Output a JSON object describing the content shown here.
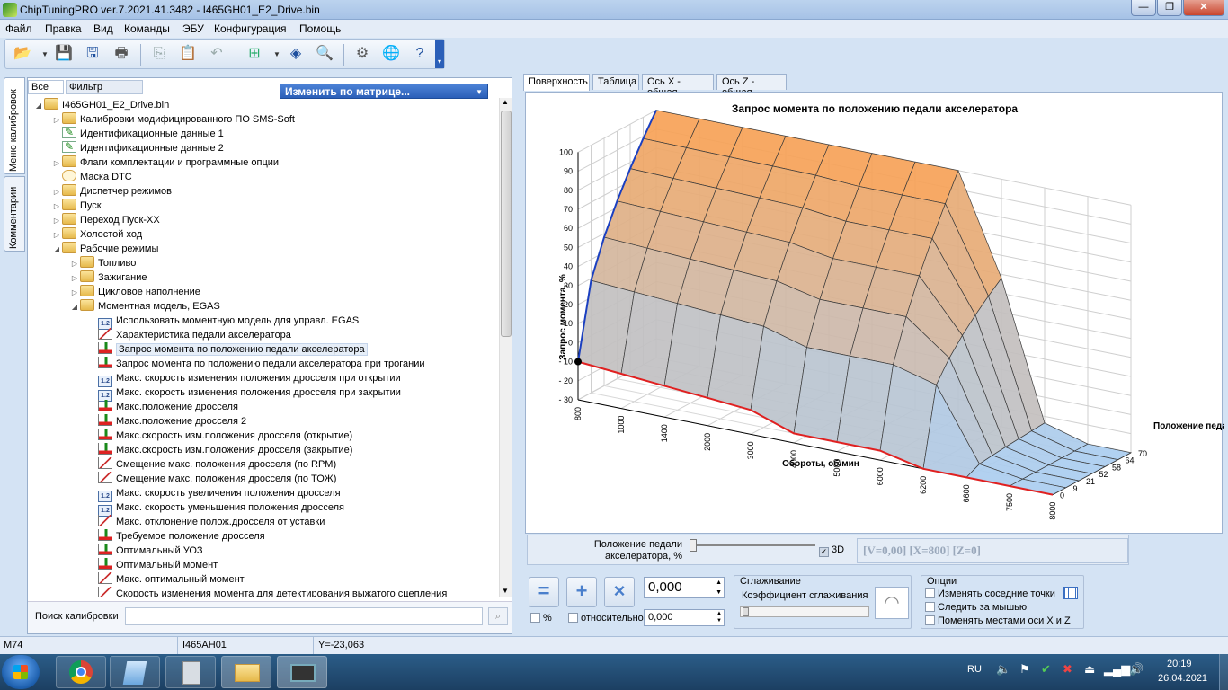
{
  "window": {
    "title": "ChipTuningPRO ver.7.2021.41.3482 - I465GH01_E2_Drive.bin",
    "minimize": "—",
    "restore": "❐",
    "close": "✕"
  },
  "menu": [
    "Файл",
    "Правка",
    "Вид",
    "Команды",
    "ЭБУ",
    "Конфигурация",
    "Помощь"
  ],
  "side_tabs": {
    "calib": "Меню калибровок",
    "comments": "Комментарии"
  },
  "filter": {
    "all": "Все",
    "filter": "Фильтр",
    "matrix": "Изменить по матрице..."
  },
  "tree": {
    "root": "I465GH01_E2_Drive.bin",
    "top": [
      {
        "label": "Калибровки модифицированного ПО SMS-Soft",
        "icon": "folder",
        "arrow": "▷"
      },
      {
        "label": "Идентификационные данные 1",
        "icon": "note",
        "arrow": ""
      },
      {
        "label": "Идентификационные данные 2",
        "icon": "note",
        "arrow": ""
      },
      {
        "label": "Флаги комплектации и программные опции",
        "icon": "folder",
        "arrow": "▷"
      },
      {
        "label": "Маска DTC",
        "icon": "mask",
        "arrow": ""
      },
      {
        "label": "Диспетчер режимов",
        "icon": "folder",
        "arrow": "▷"
      },
      {
        "label": "Пуск",
        "icon": "folder",
        "arrow": "▷"
      },
      {
        "label": "Переход Пуск-ХХ",
        "icon": "folder",
        "arrow": "▷"
      },
      {
        "label": "Холостой ход",
        "icon": "folder",
        "arrow": "▷"
      },
      {
        "label": "Рабочие режимы",
        "icon": "folder",
        "arrow": "◢"
      }
    ],
    "sub": [
      {
        "label": "Топливо",
        "icon": "folder",
        "arrow": "▷"
      },
      {
        "label": "Зажигание",
        "icon": "folder",
        "arrow": "▷"
      },
      {
        "label": "Цикловое наполнение",
        "icon": "folder",
        "arrow": "▷"
      },
      {
        "label": "Моментная модель, EGAS",
        "icon": "folder",
        "arrow": "◢"
      }
    ],
    "leaves": [
      {
        "label": "Использовать моментную модель для управл. EGAS",
        "icon": "i12"
      },
      {
        "label": "Характеристика педали акселератора",
        "icon": "wave"
      },
      {
        "label": "Запрос момента по положению педали акселератора",
        "icon": "graph",
        "selected": true
      },
      {
        "label": "Запрос момента по положению педали акселератора при трогании",
        "icon": "graph"
      },
      {
        "label": "Макс. скорость изменения положения дросселя при открытии",
        "icon": "i12"
      },
      {
        "label": "Макс. скорость изменения положения дросселя при закрытии",
        "icon": "i12"
      },
      {
        "label": "Макс.положение дросселя",
        "icon": "graph"
      },
      {
        "label": "Макс.положение дросселя 2",
        "icon": "graph"
      },
      {
        "label": "Макс.скорость изм.положения дросселя (открытие)",
        "icon": "graph"
      },
      {
        "label": "Макс.скорость изм.положения дросселя (закрытие)",
        "icon": "graph"
      },
      {
        "label": "Смещение макс. положения дросселя (по RPM)",
        "icon": "wave"
      },
      {
        "label": "Смещение макс. положения дросселя (по ТОЖ)",
        "icon": "wave"
      },
      {
        "label": "Макс. скорость увеличения положения дросселя",
        "icon": "i12"
      },
      {
        "label": "Макс. скорость уменьшения положения дросселя",
        "icon": "i12"
      },
      {
        "label": "Макс. отклонение полож.дросселя от уставки",
        "icon": "wave"
      },
      {
        "label": "Требуемое положение дросселя",
        "icon": "graph"
      },
      {
        "label": "Оптимальный УОЗ",
        "icon": "graph"
      },
      {
        "label": "Оптимальный момент",
        "icon": "graph"
      },
      {
        "label": "Макс. оптимальный момент",
        "icon": "wave"
      },
      {
        "label": "Скорость изменения момента для детектирования выжатого сцепления",
        "icon": "wave"
      }
    ]
  },
  "search": {
    "label": "Поиск калибровки",
    "value": ""
  },
  "right_tabs": [
    "Поверхность",
    "Таблица",
    "Ось X - общая",
    "Ось Z - общая"
  ],
  "chart_data": {
    "type": "surface",
    "title": "Запрос момента по положению педали акселератора",
    "zlabel": "Запрос момента, %",
    "xlabel": "Обороты, об/мин",
    "ylabel": "Положение педали",
    "ticks_z": [
      "100",
      "90",
      "80",
      "70",
      "60",
      "50",
      "40",
      "30",
      "20",
      "10",
      "0",
      "- 10",
      "- 20",
      "- 30"
    ],
    "ticks_x": [
      "800",
      "1000",
      "1400",
      "2000",
      "3000",
      "4000",
      "5000",
      "6000",
      "6200",
      "6600",
      "7500",
      "8000"
    ],
    "ticks_y": [
      "0",
      "9",
      "21",
      "52",
      "58",
      "64",
      "70"
    ],
    "zlim": [
      -30,
      100
    ],
    "grid": true
  },
  "controls": {
    "pedal_label_1": "Положение педали",
    "pedal_label_2": "акселератора, %",
    "check_3d": "3D",
    "readout": "[V=0,00] [X=800] [Z=0]",
    "value": "0,000",
    "rel_value": "0,000",
    "percent": "%",
    "relative": "относительно",
    "smoothing_title": "Сглаживание",
    "smoothing_coef": "Коэффициент сглаживания",
    "options_title": "Опции",
    "opt1": "Изменять соседние точки",
    "opt2": "Следить за мышью",
    "opt3": "Поменять местами оси X и Z"
  },
  "status": {
    "left": "M74",
    "mid": "I465AH01",
    "right": "Y=-23,063"
  },
  "taskbar": {
    "lang": "RU",
    "time": "20:19",
    "date": "26.04.2021"
  }
}
